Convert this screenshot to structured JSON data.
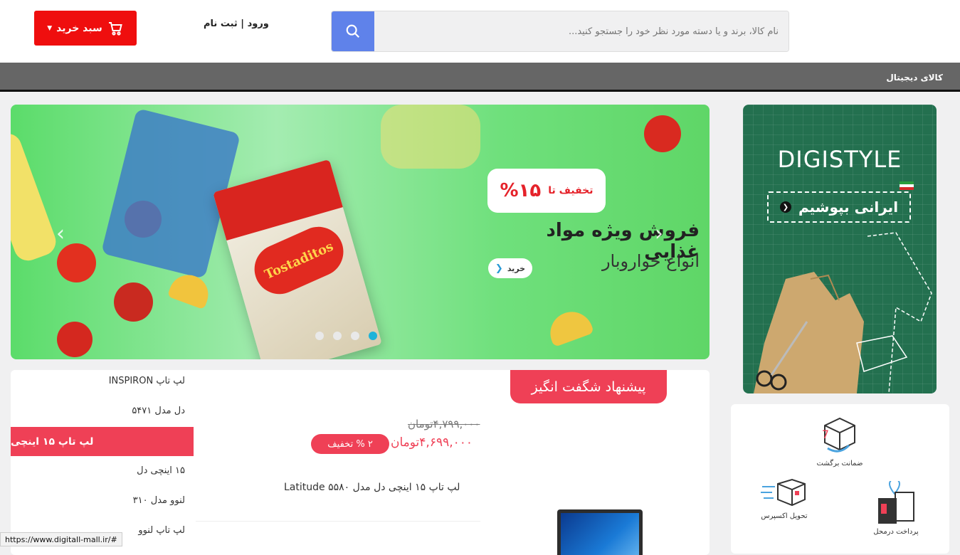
{
  "header": {
    "cart_label": "سبد خرید",
    "login_label": "ورود | ثبت نام",
    "search_placeholder": "نام کالا، برند و یا دسته مورد نظر خود را جستجو کنید..."
  },
  "nav": {
    "items": [
      "کالای دیجیتال"
    ]
  },
  "slider": {
    "discount_label": "تخفیف تا",
    "discount_value": "%۱۵",
    "title": "فروش ویژه مواد غذایی",
    "subtitle": "انواع خواروبار",
    "buy_label": "خرید",
    "product_brand": "Tostaditos",
    "slides_count": 4,
    "active_slide": 4
  },
  "side_banner": {
    "title": "DIGISTYLE",
    "tagline": "ایرانی بپوشیم"
  },
  "services": [
    {
      "label": "ضمانت برگشت",
      "icon": "return-box-icon"
    },
    {
      "label": "تحویل اکسپرس",
      "icon": "express-delivery-icon"
    },
    {
      "label": "پرداخت درمحل",
      "icon": "cod-payment-icon"
    }
  ],
  "deal": {
    "tab_label": "پیشنهاد شگفت انگیز",
    "old_price": "۴,۷۹۹,۰۰۰تومان",
    "new_price": "۴,۶۹۹,۰۰۰تومان",
    "off_label": "۲ % تخفیف",
    "product_name": "لپ تاپ ۱۵ اینچی دل مدل Latitude ۵۵۸۰",
    "categories": [
      "لپ تاپ INSPIRON",
      "دل مدل ۵۴۷۱",
      "لپ تاپ ۱۵ اینچی",
      "۱۵ اینچی دل",
      "لنوو مدل ۳۱۰",
      "لپ تاپ لنوو"
    ],
    "active_category_index": 2
  },
  "status_bar": {
    "url": "https://www.digitall-mall.ir/#"
  },
  "colors": {
    "cart_red": "#ef0e0e",
    "search_blue": "#5f82ea",
    "accent_pink": "#ef4056",
    "nav_gray": "#666666",
    "slider_green": "#5bdc6a",
    "digistyle_green": "#23704f",
    "active_dot": "#1eb3d9"
  }
}
